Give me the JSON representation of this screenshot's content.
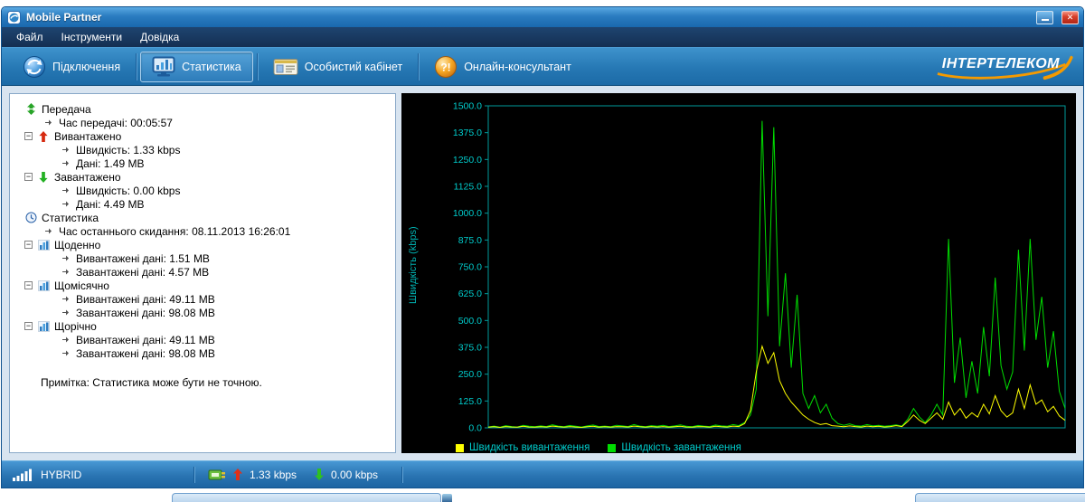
{
  "window": {
    "title": "Mobile Partner"
  },
  "menu": {
    "items": [
      {
        "label": "Файл"
      },
      {
        "label": "Інструменти"
      },
      {
        "label": "Довідка"
      }
    ]
  },
  "toolbar": {
    "buttons": [
      {
        "label": "Підключення",
        "active": false
      },
      {
        "label": "Статистика",
        "active": true
      },
      {
        "label": "Особистий кабінет",
        "active": false
      },
      {
        "label": "Онлайн-консультант",
        "active": false
      }
    ],
    "brand": "ІНТЕРТЕЛЕКОМ"
  },
  "tree": {
    "items": [
      {
        "level": 0,
        "icon": "transfer",
        "label": "Передача"
      },
      {
        "level": 1,
        "icon": "bullet",
        "label": "Час передачі: 00:05:57"
      },
      {
        "level": 0,
        "icon": "upload",
        "label": "Вивантажено",
        "expander": true
      },
      {
        "level": 2,
        "icon": "bullet",
        "label": "Швидкість: 1.33 kbps"
      },
      {
        "level": 2,
        "icon": "bullet",
        "label": "Дані: 1.49 MB"
      },
      {
        "level": 0,
        "icon": "download",
        "label": "Завантажено",
        "expander": true
      },
      {
        "level": 2,
        "icon": "bullet",
        "label": "Швидкість: 0.00 kbps"
      },
      {
        "level": 2,
        "icon": "bullet",
        "label": "Дані: 4.49 MB"
      },
      {
        "level": 0,
        "icon": "clock",
        "label": "Статистика"
      },
      {
        "level": 1,
        "icon": "bullet",
        "label": "Час останнього скидання: 08.11.2013 16:26:01"
      },
      {
        "level": 0,
        "icon": "chart",
        "label": "Щоденно",
        "expander": true
      },
      {
        "level": 2,
        "icon": "bullet",
        "label": "Вивантажені дані: 1.51 MB"
      },
      {
        "level": 2,
        "icon": "bullet",
        "label": "Завантажені дані: 4.57 MB"
      },
      {
        "level": 0,
        "icon": "chart",
        "label": "Щомісячно",
        "expander": true
      },
      {
        "level": 2,
        "icon": "bullet",
        "label": "Вивантажені дані: 49.11 MB"
      },
      {
        "level": 2,
        "icon": "bullet",
        "label": "Завантажені дані: 98.08 MB"
      },
      {
        "level": 0,
        "icon": "chart",
        "label": "Щорічно",
        "expander": true
      },
      {
        "level": 2,
        "icon": "bullet",
        "label": "Вивантажені дані: 49.11 MB"
      },
      {
        "level": 2,
        "icon": "bullet",
        "label": "Завантажені дані: 98.08 MB"
      }
    ],
    "note": "Примітка: Статистика може бути не точною."
  },
  "chart_data": {
    "type": "line",
    "title": "",
    "ylabel": "Швидкість (kbps)",
    "ylim": [
      0,
      1500
    ],
    "ytick_step": 125,
    "ytick_labels": [
      "1500.0",
      "1375.0",
      "1250.0",
      "1125.0",
      "1000.0",
      "875.0",
      "750.0",
      "625.0",
      "500.0",
      "375.0",
      "250.0",
      "125.0",
      "0.0"
    ],
    "xtick_labels": [],
    "grid": false,
    "background": "#000000",
    "axis_color": "#009a9a",
    "tick_color": "#00cccc",
    "legend_position": "bottom-left",
    "series": [
      {
        "name": "Швидкість вивантаження",
        "color": "#ffff00",
        "values": [
          3,
          5,
          2,
          6,
          4,
          3,
          7,
          4,
          3,
          5,
          4,
          8,
          5,
          3,
          6,
          4,
          2,
          5,
          7,
          3,
          5,
          3,
          6,
          5,
          4,
          8,
          5,
          3,
          6,
          4,
          6,
          3,
          5,
          7,
          4,
          3,
          6,
          5,
          3,
          7,
          5,
          4,
          8,
          6,
          20,
          80,
          260,
          380,
          300,
          350,
          220,
          160,
          120,
          90,
          60,
          40,
          25,
          15,
          20,
          10,
          8,
          5,
          9,
          6,
          4,
          8,
          5,
          7,
          4,
          6,
          10,
          6,
          30,
          60,
          35,
          20,
          45,
          70,
          40,
          120,
          60,
          90,
          45,
          70,
          50,
          110,
          65,
          150,
          80,
          50,
          70,
          180,
          90,
          200,
          110,
          130,
          75,
          100,
          55,
          35
        ]
      },
      {
        "name": "Швидкість завантаження",
        "color": "#00dd00",
        "values": [
          4,
          8,
          3,
          10,
          6,
          4,
          12,
          7,
          5,
          9,
          6,
          14,
          8,
          5,
          11,
          7,
          4,
          9,
          13,
          6,
          8,
          5,
          12,
          9,
          6,
          15,
          8,
          5,
          10,
          7,
          12,
          6,
          9,
          14,
          7,
          5,
          11,
          8,
          6,
          13,
          9,
          7,
          15,
          10,
          25,
          60,
          180,
          1430,
          520,
          1400,
          380,
          720,
          280,
          620,
          160,
          90,
          150,
          70,
          110,
          45,
          20,
          12,
          18,
          10,
          8,
          15,
          9,
          12,
          7,
          10,
          14,
          8,
          40,
          90,
          50,
          25,
          60,
          110,
          60,
          880,
          210,
          420,
          140,
          310,
          160,
          470,
          240,
          700,
          290,
          180,
          260,
          830,
          360,
          880,
          410,
          610,
          280,
          450,
          170,
          90
        ]
      }
    ]
  },
  "statusbar": {
    "network_mode": "HYBRID",
    "upload_speed": "1.33 kbps",
    "download_speed": "0.00 kbps"
  },
  "colors": {
    "upload_series": "#ffff00",
    "download_series": "#00dd00",
    "chart_axis": "#009a9a",
    "chart_text": "#00cccc",
    "titlebar_blue": "#2a7cc0",
    "close_red": "#c23018",
    "brand_orange": "#f59a00"
  }
}
